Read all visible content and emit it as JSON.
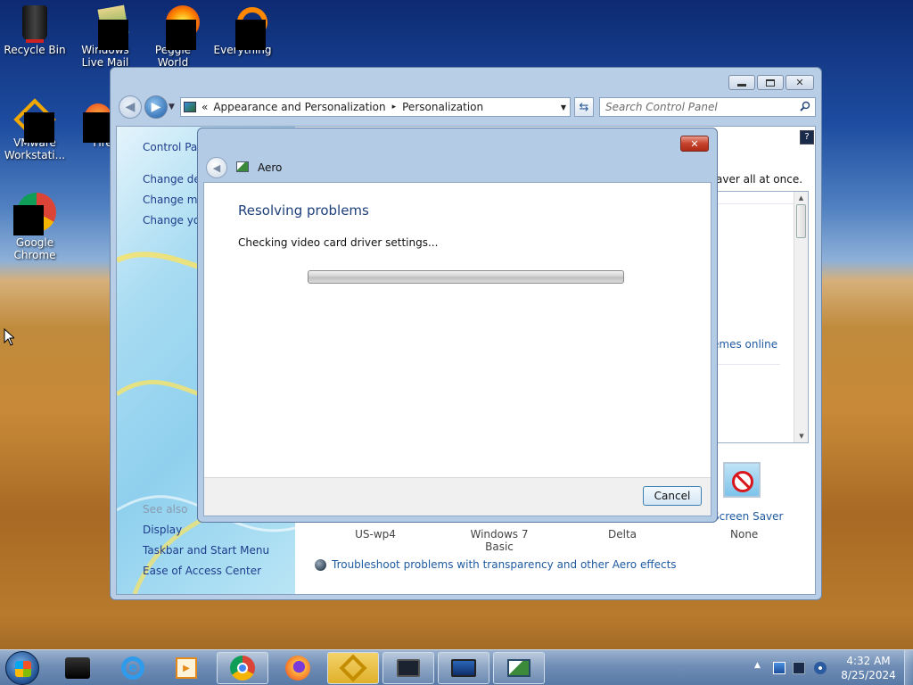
{
  "desktop": {
    "icons": [
      {
        "label": "Recycle Bin",
        "icon": "recycle-bin-icon"
      },
      {
        "label": "Windows Live Mail",
        "icon": "windows-live-mail-icon"
      },
      {
        "label": "Peggle World",
        "icon": "peggle-world-icon"
      },
      {
        "label": "Everything",
        "icon": "everything-icon"
      },
      {
        "label": "VMware Workstati...",
        "icon": "vmware-icon"
      },
      {
        "label": "Firef",
        "icon": "firefox-icon"
      },
      {
        "label": "Google Chrome",
        "icon": "chrome-icon"
      }
    ]
  },
  "control_panel": {
    "breadcrumb": {
      "overflow": "«",
      "items": [
        "Appearance and Personalization",
        "Personalization"
      ],
      "separator": "▸"
    },
    "search_placeholder": "Search Control Panel",
    "caption": {
      "minimize": "▭",
      "maximize": "▢",
      "close": "✕"
    },
    "sidebar": {
      "home": "Control Pan",
      "links": [
        "Change des",
        "Change mo",
        "Change you"
      ],
      "see_also_title": "See also",
      "see_also": [
        "Display",
        "Taskbar and Start Menu",
        "Ease of Access Center"
      ]
    },
    "main": {
      "header_fragment": "aver all at once.",
      "themes_online_fragment": "emes online",
      "screen_saver_label": "Screen Saver",
      "screen_saver_value": "None",
      "theme_labels": [
        "US-wp4",
        "Windows 7 Basic",
        "Delta"
      ],
      "troubleshoot_link": "Troubleshoot problems with transparency and other Aero effects"
    }
  },
  "dialog": {
    "title": "Aero",
    "heading": "Resolving problems",
    "status": "Checking video card driver settings...",
    "cancel_label": "Cancel",
    "close_glyph": "✕"
  },
  "taskbar": {
    "clock_time": "4:32 AM",
    "clock_date": "8/25/2024",
    "items": [
      {
        "name": "start-button",
        "icon": "windows-orb-icon"
      },
      {
        "name": "taskbar-item-1",
        "icon": "dark-box-icon"
      },
      {
        "name": "taskbar-item-ie",
        "icon": "internet-explorer-icon"
      },
      {
        "name": "taskbar-item-media",
        "icon": "media-player-icon"
      },
      {
        "name": "taskbar-item-chrome",
        "icon": "chrome-icon"
      },
      {
        "name": "taskbar-item-firefox",
        "icon": "firefox-icon"
      },
      {
        "name": "taskbar-item-vmware",
        "icon": "vmware-icon"
      },
      {
        "name": "taskbar-item-monitor1",
        "icon": "monitor-icon"
      },
      {
        "name": "taskbar-item-monitor2",
        "icon": "monitor-icon"
      },
      {
        "name": "taskbar-item-personalization",
        "icon": "personalization-icon"
      }
    ]
  }
}
